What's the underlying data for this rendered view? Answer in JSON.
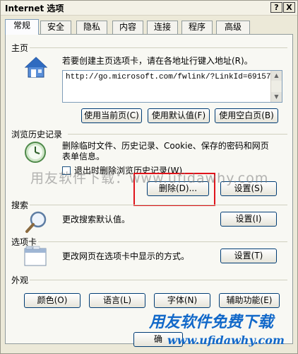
{
  "window": {
    "title": "Internet 选项",
    "help_label": "?",
    "close_label": "X"
  },
  "tabs": [
    "常规",
    "安全",
    "隐私",
    "内容",
    "连接",
    "程序",
    "高级"
  ],
  "home": {
    "section": "主页",
    "desc": "若要创建主页选项卡，请在各地址行键入地址(R)。",
    "url": "http://go.microsoft.com/fwlink/?LinkId=69157",
    "btn_current": "使用当前页(C)",
    "btn_default": "使用默认值(F)",
    "btn_blank": "使用空白页(B)"
  },
  "history": {
    "section": "浏览历史记录",
    "desc1": "删除临时文件、历史记录、Cookie、保存的密码和网页",
    "desc2": "表单信息。",
    "checkbox": "退出时删除浏览历史记录(W)",
    "btn_delete": "删除(D)...",
    "btn_settings": "设置(S)"
  },
  "search": {
    "section": "搜索",
    "desc": "更改搜索默认值。",
    "btn_settings": "设置(I)"
  },
  "tabs_section": {
    "section": "选项卡",
    "desc": "更改网页在选项卡中显示的方式。",
    "btn_settings": "设置(T)"
  },
  "appearance": {
    "section": "外观",
    "btn_colors": "颜色(O)",
    "btn_languages": "语言(L)",
    "btn_fonts": "字体(N)",
    "btn_accessibility": "辅助功能(E)"
  },
  "footer": {
    "btn_ok": "确"
  },
  "watermark": {
    "text": "用友软件下载：www.ufidawhy.com"
  },
  "brand": {
    "name": "用友软件免费下载",
    "url": "www.ufidawhy.com"
  },
  "colors": {
    "highlight": "#e0141b",
    "brand": "#1168c9"
  }
}
